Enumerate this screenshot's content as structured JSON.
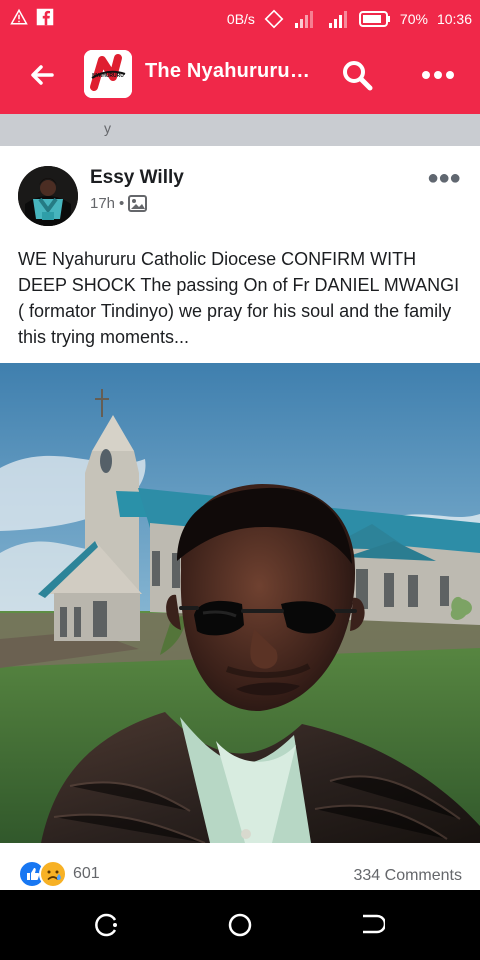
{
  "status": {
    "network_speed": "0B/s",
    "battery": "70%",
    "time": "10:36"
  },
  "header": {
    "title": "The Nyahururu…",
    "logo_letter": "N",
    "logo_text": "NYAHURURU"
  },
  "previous_fragment": "y",
  "post": {
    "author": "Essy Willy",
    "time": "17h",
    "separator": "•",
    "text": "WE Nyahururu Catholic Diocese CONFIRM WITH DEEP SHOCK The passing On of Fr DANIEL MWANGI ( formator Tindinyo) we pray for his soul and the family this trying moments...",
    "reaction_count": "601",
    "comments": "334 Comments"
  },
  "colors": {
    "brand": "#f02849",
    "like": "#1877f2",
    "sad": "#f7b125"
  },
  "icons": [
    "alert-icon",
    "facebook-icon",
    "data-speed-icon",
    "rotate-icon",
    "signal-icon",
    "battery-icon",
    "back-arrow-icon",
    "search-icon",
    "more-icon",
    "public-photo-icon",
    "like-reaction-icon",
    "sad-reaction-icon",
    "recent-apps-icon",
    "home-icon",
    "back-icon"
  ]
}
